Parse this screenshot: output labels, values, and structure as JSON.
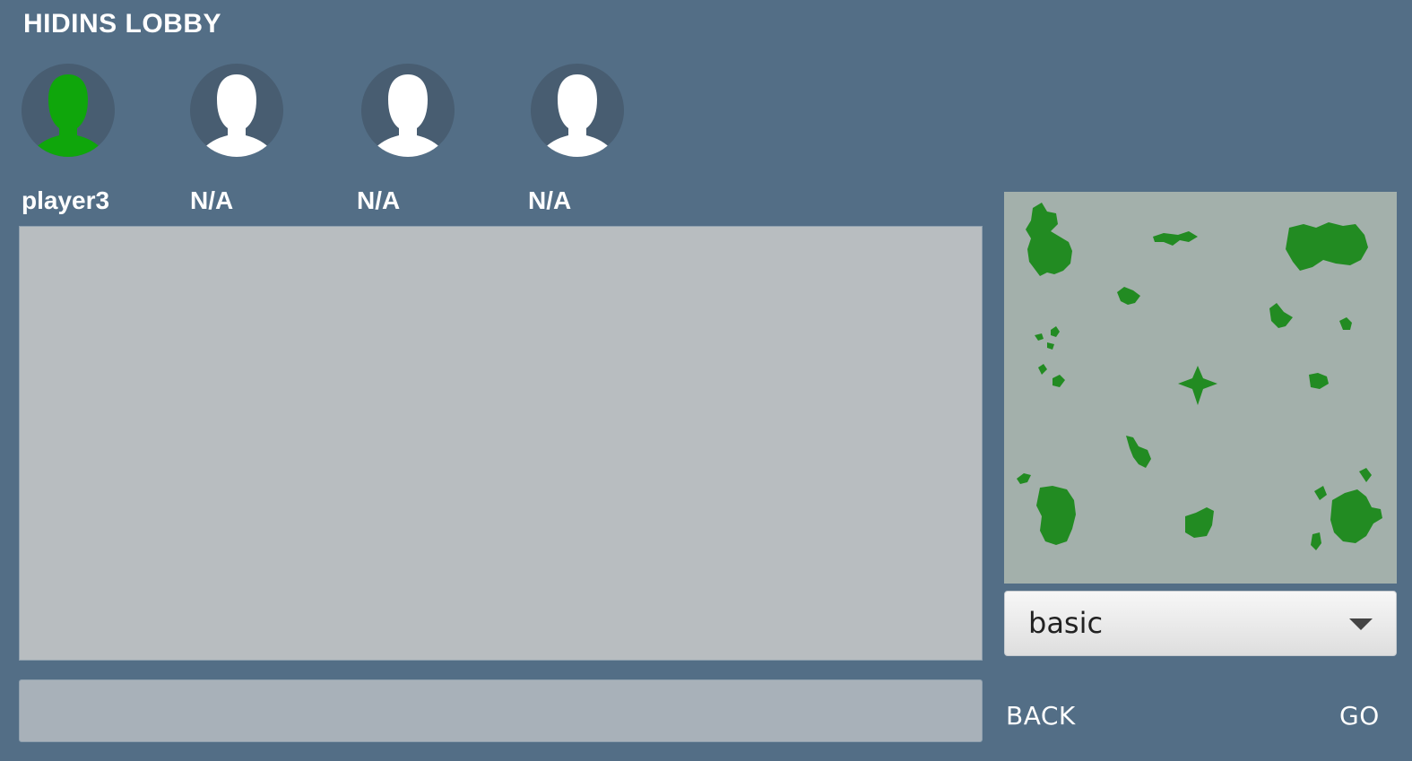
{
  "lobby": {
    "title": "HIDINS LOBBY"
  },
  "players": [
    {
      "name": "player3",
      "avatar_icon": "person-silhouette-icon",
      "avatar_color": "#0fa60b",
      "ready": true
    },
    {
      "name": "N/A",
      "avatar_icon": "person-silhouette-icon",
      "avatar_color": "#ffffff",
      "ready": false
    },
    {
      "name": "N/A",
      "avatar_icon": "person-silhouette-icon",
      "avatar_color": "#ffffff",
      "ready": false
    },
    {
      "name": "N/A",
      "avatar_icon": "person-silhouette-icon",
      "avatar_color": "#ffffff",
      "ready": false
    }
  ],
  "chat": {
    "messages": [],
    "input_value": "",
    "input_placeholder": ""
  },
  "map": {
    "selected": "basic",
    "dropdown_icon": "chevron-down-icon",
    "land_color": "#228b22",
    "water_color": "#a3b0ab"
  },
  "buttons": {
    "back_label": "BACK",
    "go_label": "GO"
  },
  "colors": {
    "background": "#536e86",
    "panel": "#b8bdc0",
    "input": "#a8b1b9"
  }
}
